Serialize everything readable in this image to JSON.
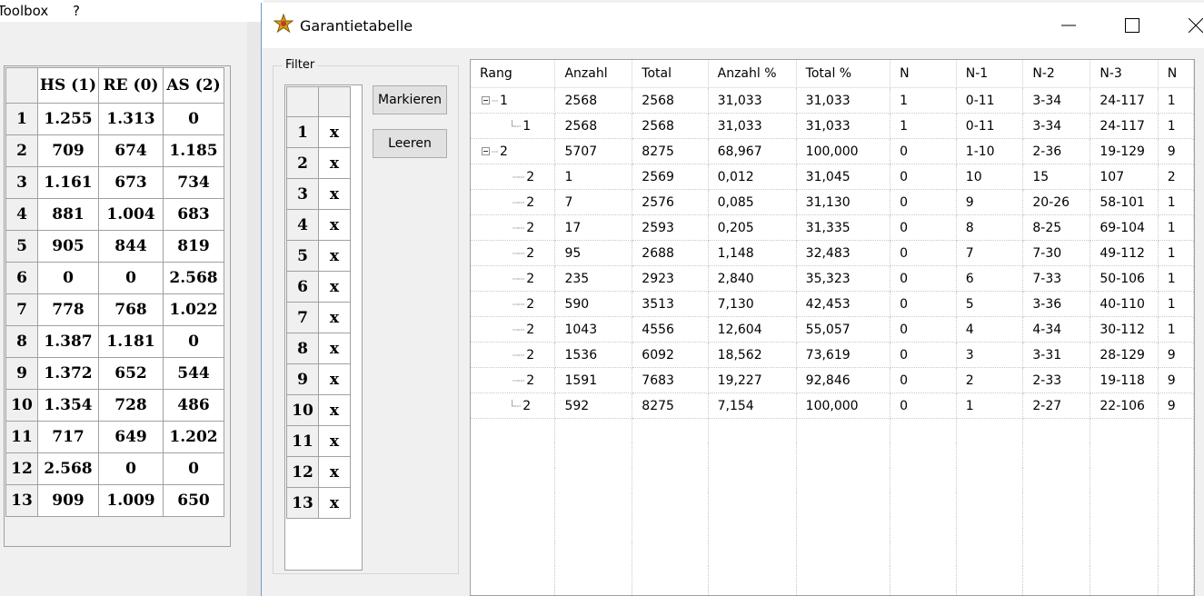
{
  "background_app": {
    "menu": [
      "Toolbox",
      "?"
    ],
    "grid": {
      "headers": [
        "HS (1)",
        "RE (0)",
        "AS (2)"
      ],
      "rows": [
        {
          "n": "1",
          "v": [
            "1.255",
            "1.313",
            "0"
          ]
        },
        {
          "n": "2",
          "v": [
            "709",
            "674",
            "1.185"
          ]
        },
        {
          "n": "3",
          "v": [
            "1.161",
            "673",
            "734"
          ]
        },
        {
          "n": "4",
          "v": [
            "881",
            "1.004",
            "683"
          ]
        },
        {
          "n": "5",
          "v": [
            "905",
            "844",
            "819"
          ]
        },
        {
          "n": "6",
          "v": [
            "0",
            "0",
            "2.568"
          ]
        },
        {
          "n": "7",
          "v": [
            "778",
            "768",
            "1.022"
          ]
        },
        {
          "n": "8",
          "v": [
            "1.387",
            "1.181",
            "0"
          ]
        },
        {
          "n": "9",
          "v": [
            "1.372",
            "652",
            "544"
          ]
        },
        {
          "n": "10",
          "v": [
            "1.354",
            "728",
            "486"
          ]
        },
        {
          "n": "11",
          "v": [
            "717",
            "649",
            "1.202"
          ]
        },
        {
          "n": "12",
          "v": [
            "2.568",
            "0",
            "0"
          ]
        },
        {
          "n": "13",
          "v": [
            "909",
            "1.009",
            "650"
          ]
        }
      ]
    }
  },
  "dialog": {
    "title": "Garantietabelle",
    "filter": {
      "label": "Filter",
      "rows": [
        {
          "n": "1",
          "v": "x"
        },
        {
          "n": "2",
          "v": "x"
        },
        {
          "n": "3",
          "v": "x"
        },
        {
          "n": "4",
          "v": "x"
        },
        {
          "n": "5",
          "v": "x"
        },
        {
          "n": "6",
          "v": "x"
        },
        {
          "n": "7",
          "v": "x"
        },
        {
          "n": "8",
          "v": "x"
        },
        {
          "n": "9",
          "v": "x"
        },
        {
          "n": "10",
          "v": "x"
        },
        {
          "n": "11",
          "v": "x"
        },
        {
          "n": "12",
          "v": "x"
        },
        {
          "n": "13",
          "v": "x"
        }
      ]
    },
    "buttons": {
      "mark": "Markieren",
      "clear": "Leeren"
    },
    "tree": {
      "columns": [
        "Rang",
        "Anzahl",
        "Total",
        "Anzahl %",
        "Total %",
        "N",
        "N-1",
        "N-2",
        "N-3",
        "N"
      ],
      "rows": [
        {
          "type": "parent",
          "rang": "1",
          "cells": [
            "2568",
            "2568",
            "31,033",
            "31,033",
            "1",
            "0-11",
            "3-34",
            "24-117",
            "1"
          ]
        },
        {
          "type": "child-last",
          "rang": "1",
          "cells": [
            "2568",
            "2568",
            "31,033",
            "31,033",
            "1",
            "0-11",
            "3-34",
            "24-117",
            "1"
          ]
        },
        {
          "type": "parent",
          "rang": "2",
          "cells": [
            "5707",
            "8275",
            "68,967",
            "100,000",
            "0",
            "1-10",
            "2-36",
            "19-129",
            "9"
          ]
        },
        {
          "type": "child",
          "rang": "2",
          "cells": [
            "1",
            "2569",
            "0,012",
            "31,045",
            "0",
            "10",
            "15",
            "107",
            "2"
          ]
        },
        {
          "type": "child",
          "rang": "2",
          "cells": [
            "7",
            "2576",
            "0,085",
            "31,130",
            "0",
            "9",
            "20-26",
            "58-101",
            "1"
          ]
        },
        {
          "type": "child",
          "rang": "2",
          "cells": [
            "17",
            "2593",
            "0,205",
            "31,335",
            "0",
            "8",
            "8-25",
            "69-104",
            "1"
          ]
        },
        {
          "type": "child",
          "rang": "2",
          "cells": [
            "95",
            "2688",
            "1,148",
            "32,483",
            "0",
            "7",
            "7-30",
            "49-112",
            "1"
          ]
        },
        {
          "type": "child",
          "rang": "2",
          "cells": [
            "235",
            "2923",
            "2,840",
            "35,323",
            "0",
            "6",
            "7-33",
            "50-106",
            "1"
          ]
        },
        {
          "type": "child",
          "rang": "2",
          "cells": [
            "590",
            "3513",
            "7,130",
            "42,453",
            "0",
            "5",
            "3-36",
            "40-110",
            "1"
          ]
        },
        {
          "type": "child",
          "rang": "2",
          "cells": [
            "1043",
            "4556",
            "12,604",
            "55,057",
            "0",
            "4",
            "4-34",
            "30-112",
            "1"
          ]
        },
        {
          "type": "child",
          "rang": "2",
          "cells": [
            "1536",
            "6092",
            "18,562",
            "73,619",
            "0",
            "3",
            "3-31",
            "28-129",
            "9"
          ]
        },
        {
          "type": "child",
          "rang": "2",
          "cells": [
            "1591",
            "7683",
            "19,227",
            "92,846",
            "0",
            "2",
            "2-33",
            "19-118",
            "9"
          ]
        },
        {
          "type": "child-last",
          "rang": "2",
          "cells": [
            "592",
            "8275",
            "7,154",
            "100,000",
            "0",
            "1",
            "2-27",
            "22-106",
            "9"
          ]
        }
      ]
    }
  },
  "icons": {
    "title": "app-star-icon",
    "minimize": "minimize-icon",
    "maximize": "maximize-icon",
    "close": "close-icon"
  }
}
